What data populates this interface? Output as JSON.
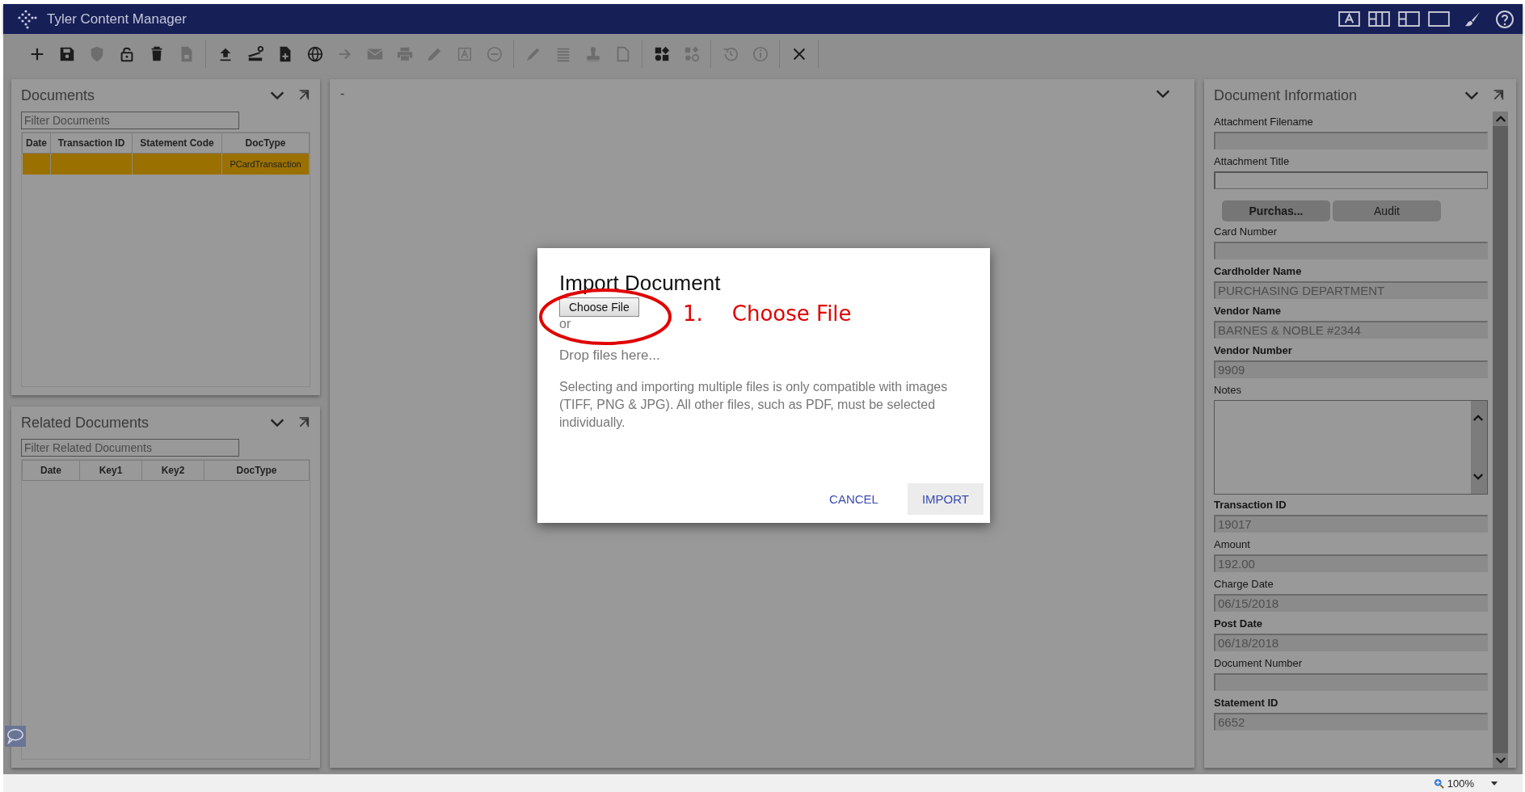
{
  "window": {
    "title": "Tyler Content Manager"
  },
  "toolbar": {
    "groups": [
      [
        {
          "disabled": false
        },
        {
          "disabled": false
        },
        {
          "disabled": true
        },
        {
          "disabled": false
        },
        {
          "disabled": false
        },
        {
          "disabled": true
        }
      ],
      [
        {
          "disabled": false
        },
        {
          "disabled": false
        },
        {
          "disabled": false
        },
        {
          "disabled": false
        },
        {
          "disabled": true
        },
        {
          "disabled": true
        },
        {
          "disabled": true
        },
        {
          "disabled": true
        },
        {
          "disabled": true
        },
        {
          "disabled": true
        }
      ],
      [
        {
          "disabled": true
        },
        {
          "disabled": true
        },
        {
          "disabled": true
        },
        {
          "disabled": true
        }
      ],
      [
        {
          "disabled": false
        },
        {
          "disabled": true
        }
      ],
      [
        {
          "disabled": true
        },
        {
          "disabled": true
        }
      ],
      [
        {
          "disabled": false
        }
      ]
    ]
  },
  "documents": {
    "title": "Documents",
    "filter": {
      "placeholder": "Filter Documents"
    },
    "table": {
      "columns": [
        "Date",
        "Transaction ID",
        "Statement Code",
        "DocType"
      ],
      "rows": [
        {
          "selected": true,
          "cells": [
            null,
            null,
            null,
            "PCardTransaction"
          ]
        }
      ]
    }
  },
  "related_documents": {
    "title": "Related Documents",
    "filter": {
      "placeholder": "Filter Related Documents"
    },
    "table": {
      "columns": [
        "Date",
        "Key1",
        "Key2",
        "DocType"
      ]
    }
  },
  "viewer": {
    "title": "-"
  },
  "document_information": {
    "title": "Document Information",
    "items": [
      {
        "kind": "field",
        "label": "Attachment Filename",
        "required": false,
        "disabled": true
      },
      {
        "kind": "field",
        "label": "Attachment Title",
        "required": false,
        "disabled": false
      },
      {
        "kind": "tabs",
        "tabs": [
          {
            "label": "Purchas...",
            "selected": true
          },
          {
            "label": "Audit",
            "selected": false
          }
        ]
      },
      {
        "kind": "field",
        "label": "Card Number",
        "required": false,
        "disabled": true
      },
      {
        "kind": "field",
        "label": "Cardholder Name",
        "required": true,
        "disabled": true,
        "value": "PURCHASING DEPARTMENT"
      },
      {
        "kind": "field",
        "label": "Vendor Name",
        "required": true,
        "disabled": true,
        "value": "BARNES & NOBLE #2344"
      },
      {
        "kind": "field",
        "label": "Vendor Number",
        "required": true,
        "disabled": true,
        "value": "9909"
      },
      {
        "kind": "textarea",
        "label": "Notes",
        "required": false,
        "disabled": false
      },
      {
        "kind": "field",
        "label": "Transaction ID",
        "required": true,
        "disabled": true,
        "value": "19017"
      },
      {
        "kind": "field",
        "label": "Amount",
        "required": false,
        "disabled": true,
        "value": "192.00"
      },
      {
        "kind": "field",
        "label": "Charge Date",
        "required": false,
        "disabled": true,
        "value": "06/15/2018"
      },
      {
        "kind": "field",
        "label": "Post Date",
        "required": true,
        "disabled": true,
        "value": "06/18/2018"
      },
      {
        "kind": "field",
        "label": "Document Number",
        "required": false,
        "disabled": true
      },
      {
        "kind": "field",
        "label": "Statement ID",
        "required": true,
        "disabled": true,
        "value": "6652"
      }
    ]
  },
  "dialog": {
    "title": "Import Document",
    "choose_button": "Choose File",
    "or_text": "or",
    "drop_text": "Drop files here...",
    "note": "Selecting and importing multiple files is only compatible with images (TIFF, PNG & JPG). All other files, such as PDF, must be selected individually.",
    "buttons": [
      {
        "label": "CANCEL",
        "kind": "flat"
      },
      {
        "label": "IMPORT",
        "kind": "raised"
      }
    ]
  },
  "annotation": {
    "number": "1.",
    "text": "Choose File"
  },
  "status_bar": {
    "zoom": "100%"
  }
}
